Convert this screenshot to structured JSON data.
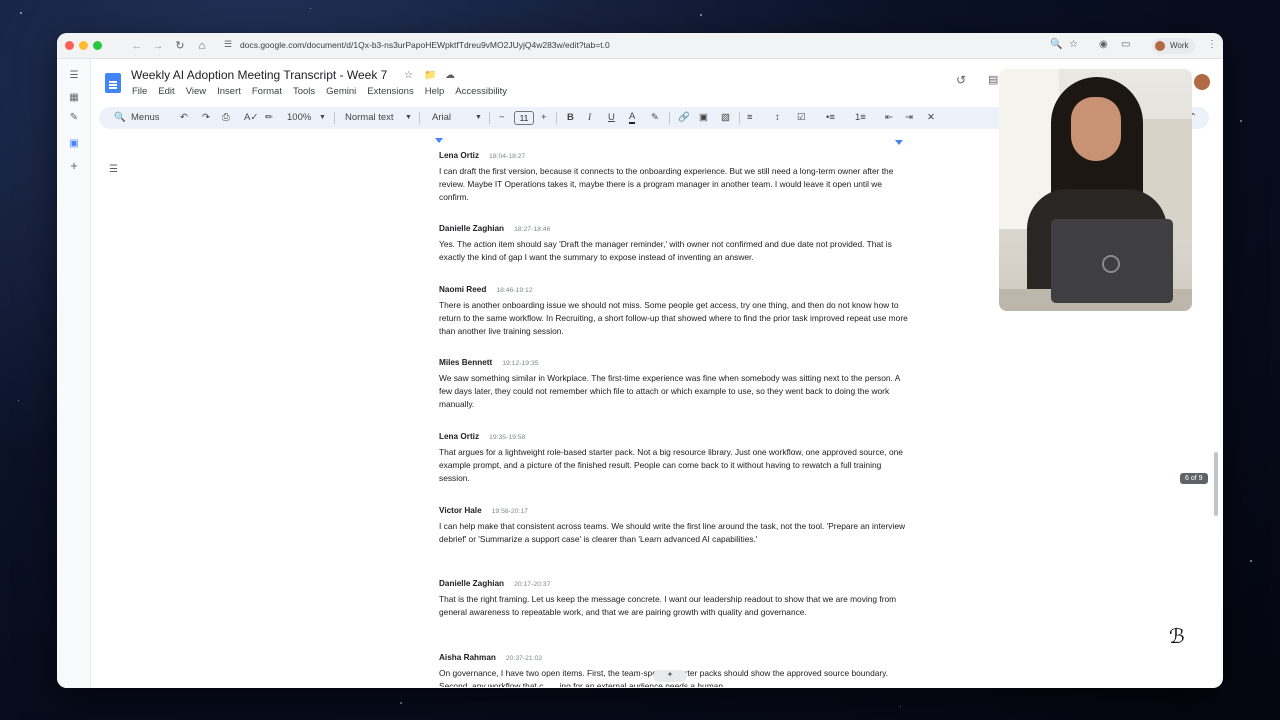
{
  "browser": {
    "url": "docs.google.com/document/d/1Qx-b3-ns3urPapoHEWpktfTdreu9vMO2JUyjQ4w283w/edit?tab=t.0",
    "profile_label": "Work"
  },
  "doc": {
    "title": "Weekly AI Adoption Meeting Transcript - Week 7",
    "menu": [
      "File",
      "Edit",
      "View",
      "Insert",
      "Format",
      "Tools",
      "Gemini",
      "Extensions",
      "Help",
      "Accessibility"
    ]
  },
  "toolbar": {
    "menus_label": "Menus",
    "zoom": "100%",
    "style": "Normal text",
    "font": "Arial",
    "font_size": "11"
  },
  "page_badge": "6 of 9",
  "transcript": [
    {
      "speaker": "Lena Ortiz",
      "time": "18:04-18:27",
      "text": "I can draft the first version, because it connects to the onboarding experience. But we still need a long-term owner after the review. Maybe IT Operations takes it, maybe there is a program manager in another team. I would leave it open until we confirm."
    },
    {
      "speaker": "Danielle Zaghian",
      "time": "18:27-18:46",
      "text": "Yes. The action item should say 'Draft the manager reminder,' with owner not confirmed and due date not provided. That is exactly the kind of gap I want the summary to expose instead of inventing an answer."
    },
    {
      "speaker": "Naomi Reed",
      "time": "18:46-19:12",
      "text": "There is another onboarding issue we should not miss. Some people get access, try one thing, and then do not know how to return to the same workflow. In Recruiting, a short follow-up that showed where to find the prior task improved repeat use more than another live training session."
    },
    {
      "speaker": "Miles Bennett",
      "time": "19:12-19:35",
      "text": "We saw something similar in Workplace. The first-time experience was fine when somebody was sitting next to the person. A few days later, they could not remember which file to attach or which example to use, so they went back to doing the work manually."
    },
    {
      "speaker": "Lena Ortiz",
      "time": "19:35-19:58",
      "text": "That argues for a lightweight role-based starter pack. Not a big resource library. Just one workflow, one approved source, one example prompt, and a picture of the finished result. People can come back to it without having to rewatch a full training session."
    },
    {
      "speaker": "Victor Hale",
      "time": "19:58-20:17",
      "text": "I can help make that consistent across teams. We should write the first line around the task, not the tool. 'Prepare an interview debrief' or 'Summarize a support case' is clearer than 'Learn advanced AI capabilities.'"
    },
    {
      "speaker": "Danielle Zaghian",
      "time": "20:17-20:37",
      "text": "That is the right framing. Let us keep the message concrete. I want our leadership readout to show that we are moving from general awareness to repeatable work, and that we are pairing growth with quality and governance."
    },
    {
      "speaker": "Aisha Rahman",
      "time": "20:37-21:02",
      "text": "On governance, I have two open items. First, the team-specific starter packs should show the approved source boundary. Second, any workflow that c... ...ing for an external audience needs a human"
    }
  ],
  "colors": {
    "accent": "#4285f4",
    "toolbar_bg": "#edf2fa",
    "chrome_bg": "#f1f3f4"
  }
}
